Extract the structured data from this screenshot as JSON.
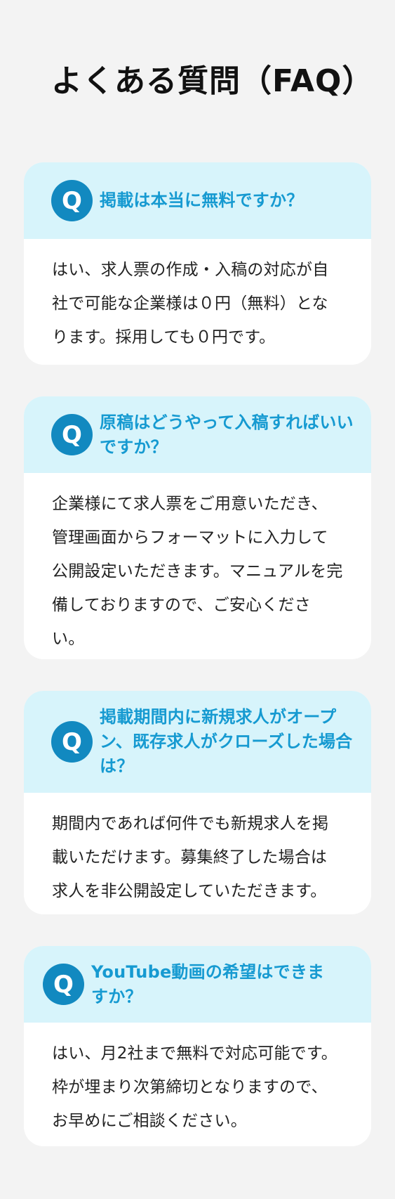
{
  "page": {
    "title": "よくある質問（FAQ）"
  },
  "faq": [
    {
      "badge": "Q",
      "question": "掲載は本当に無料ですか？",
      "answer": "はい、求人票の作成・入稿の対応が自社で可能な企業様は０円（無料）となります。採用しても０円です。"
    },
    {
      "badge": "Q",
      "question": "原稿はどうやって入稿すればいいですか？",
      "answer": "企業様にて求人票をご用意いただき、管理画面からフォーマットに入力して公開設定いただきます。マニュアルを完備しておりますので、ご安心ください。"
    },
    {
      "badge": "Q",
      "question": "掲載期間内に新規求人がオープン、既存求人がクローズした場合は？",
      "answer": "期間内であれば何件でも新規求人を掲載いただけます。募集終了した場合は求人を非公開設定していただきます。"
    },
    {
      "badge": "Q",
      "question": "YouTube動画の希望はできますか？",
      "answer": "はい、月2社まで無料で対応可能です。枠が埋まり次第締切となりますので、お早めにご相談ください。"
    }
  ]
}
